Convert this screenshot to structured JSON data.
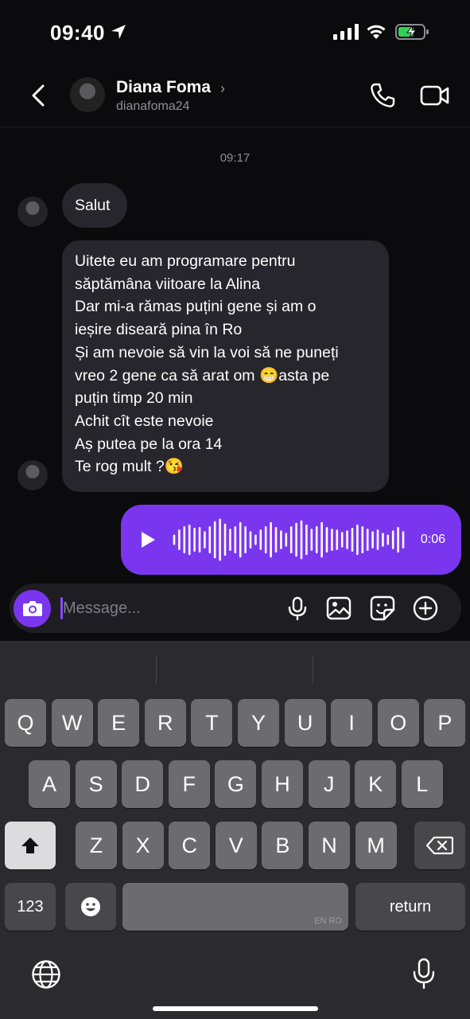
{
  "status_bar": {
    "time": "09:40"
  },
  "header": {
    "name": "Diana Foma",
    "username": "dianafoma24"
  },
  "chat": {
    "timestamp": "09:17",
    "messages": [
      {
        "from": "them",
        "lines": [
          "Salut"
        ]
      },
      {
        "from": "them",
        "lines": [
          "Uitete eu am programare pentru",
          "săptămâna viitoare la Alina",
          "Dar mi-a rămas puțini gene și am o",
          "ieșire diseară pina în Ro",
          "Și am nevoie să vin la voi să ne puneți",
          "vreo 2 gene ca să arat om 😁asta pe",
          "puțin timp 20 min",
          "Achit cît este nevoie",
          "Aș putea pe la ora 14",
          "Te rog mult ?😘"
        ]
      },
      {
        "from": "me",
        "type": "voice",
        "duration": "0:06"
      }
    ]
  },
  "composer": {
    "placeholder": "Message..."
  },
  "keyboard": {
    "row1": [
      "Q",
      "W",
      "E",
      "R",
      "T",
      "Y",
      "U",
      "I",
      "O",
      "P"
    ],
    "row2": [
      "A",
      "S",
      "D",
      "F",
      "G",
      "H",
      "J",
      "K",
      "L"
    ],
    "row3": [
      "Z",
      "X",
      "C",
      "V",
      "B",
      "N",
      "M"
    ],
    "numbers_label": "123",
    "return_label": "return",
    "space_lang": "EN RO"
  },
  "colors": {
    "accent": "#7a36ee",
    "bubble_in": "#26262c",
    "background": "#0b0b0e",
    "keyboard": "#2b2b2f"
  }
}
